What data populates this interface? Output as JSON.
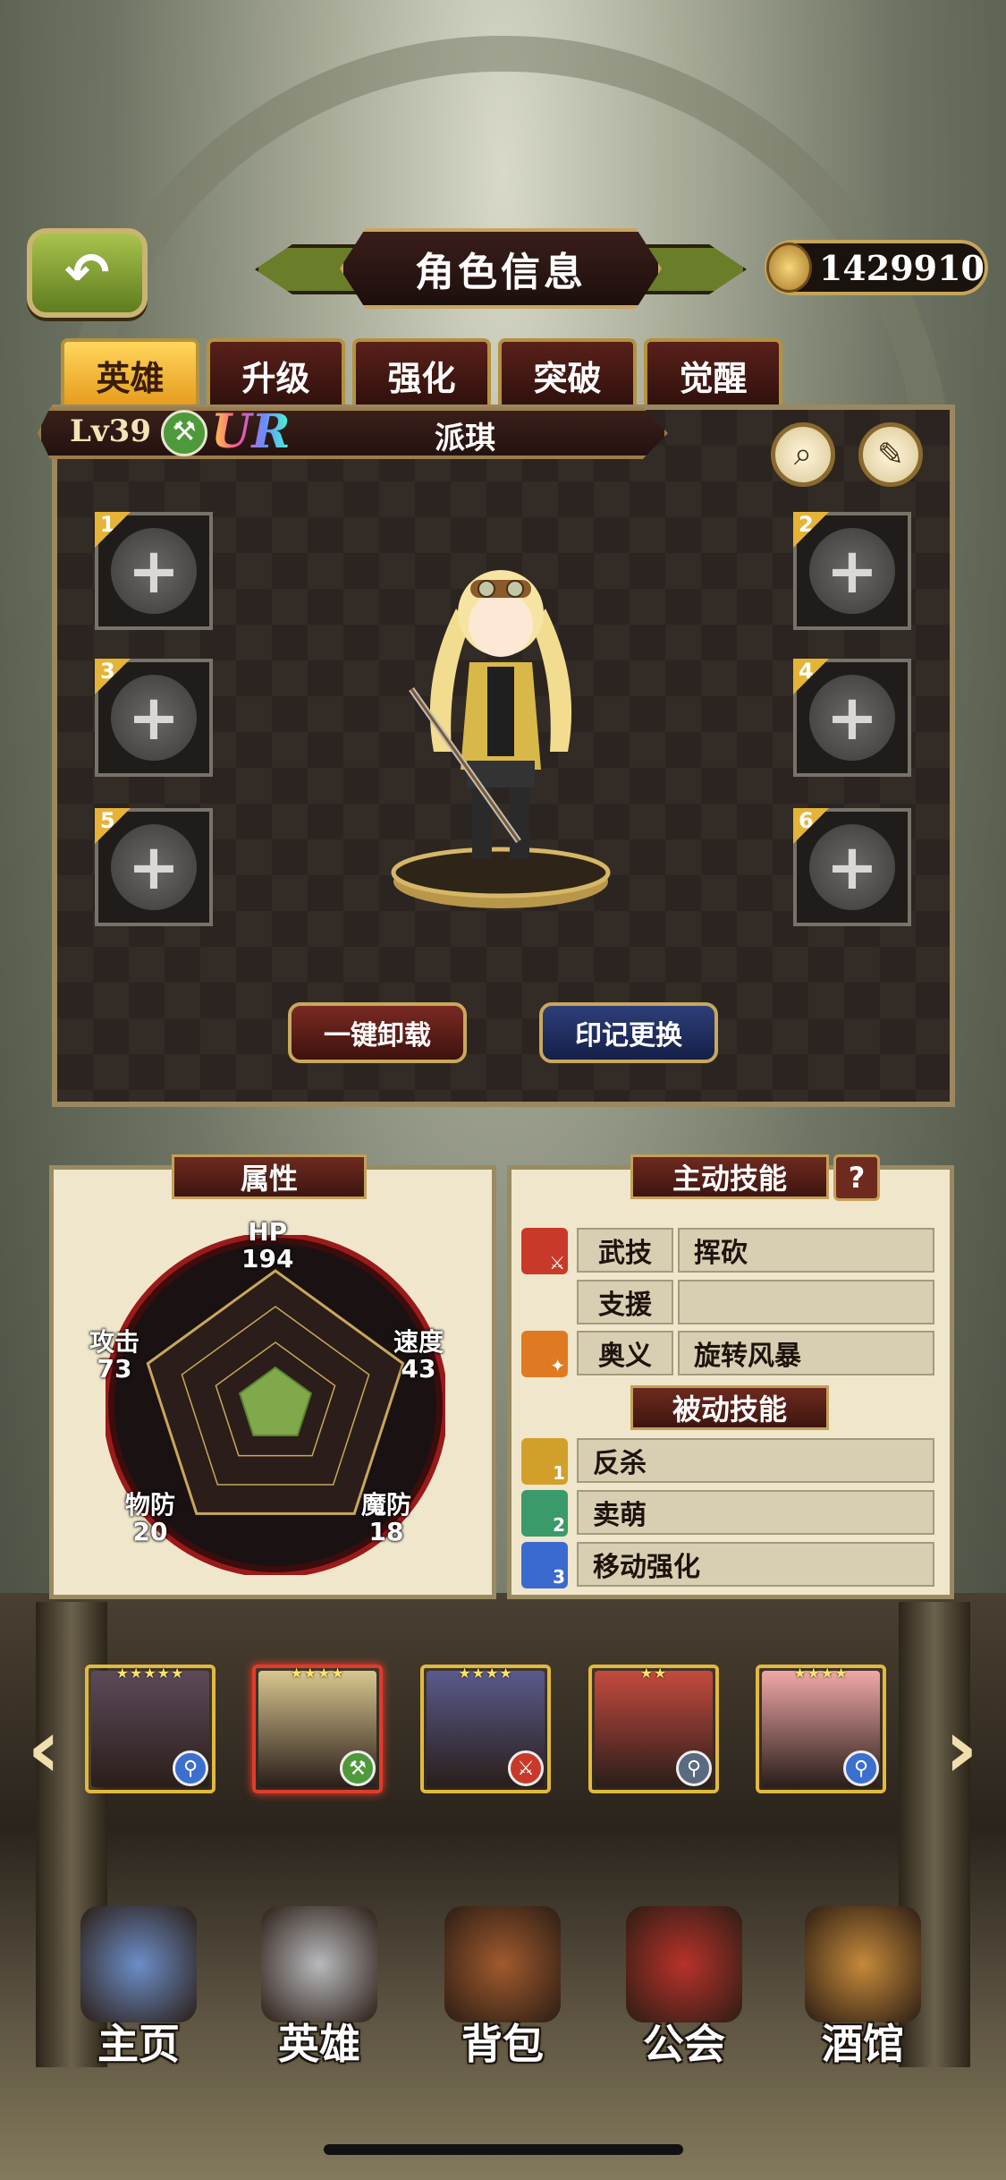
{
  "header": {
    "title": "角色信息",
    "gold": "1429910",
    "back_icon": "back-arrow-icon"
  },
  "tabs": [
    {
      "label": "英雄",
      "active": true
    },
    {
      "label": "升级",
      "active": false
    },
    {
      "label": "强化",
      "active": false
    },
    {
      "label": "突破",
      "active": false
    },
    {
      "label": "觉醒",
      "active": false
    }
  ],
  "hero": {
    "level": "Lv39",
    "rarity": "UR",
    "name": "派琪",
    "class_icon": "axe-icon"
  },
  "slots": [
    "1",
    "2",
    "3",
    "4",
    "5",
    "6"
  ],
  "actions": {
    "unequip_all": "一键卸载",
    "change_mark": "印记更换"
  },
  "attributes": {
    "title": "属性",
    "stats": [
      {
        "name": "HP",
        "value": "194"
      },
      {
        "name": "速度",
        "value": "43"
      },
      {
        "name": "魔防",
        "value": "18"
      },
      {
        "name": "物防",
        "value": "20"
      },
      {
        "name": "攻击",
        "value": "73"
      }
    ]
  },
  "skills": {
    "active_title": "主动技能",
    "help": "?",
    "active": [
      {
        "type": "武技",
        "name": "挥砍"
      },
      {
        "type": "支援",
        "name": ""
      },
      {
        "type": "奥义",
        "name": "旋转风暴"
      }
    ],
    "passive_title": "被动技能",
    "passive": [
      {
        "index": "1",
        "name": "反杀"
      },
      {
        "index": "2",
        "name": "卖萌"
      },
      {
        "index": "3",
        "name": "移动强化"
      }
    ]
  },
  "hero_list": [
    {
      "stars": "★★★★★",
      "class": "staff",
      "class_glyph": "⚲",
      "color": "#3b6fd0",
      "selected": false,
      "portrait": "#5d4a5a"
    },
    {
      "stars": "★★★★",
      "class": "axe",
      "class_glyph": "⚒",
      "color": "#4e9a3a",
      "selected": true,
      "portrait": "#d9c68f"
    },
    {
      "stars": "★★★★",
      "class": "sword",
      "class_glyph": "⚔",
      "color": "#c9392a",
      "selected": false,
      "portrait": "#5a5a8c"
    },
    {
      "stars": "★★",
      "class": "staff",
      "class_glyph": "⚲",
      "color": "#5a6a80",
      "selected": false,
      "portrait": "#c44a3e"
    },
    {
      "stars": "★★★★",
      "class": "staff",
      "class_glyph": "⚲",
      "color": "#3b6fd0",
      "selected": false,
      "portrait": "#f0a8a8"
    }
  ],
  "nav": [
    {
      "label": "主页",
      "icon": "castle-icon",
      "color": "#6c8ec9"
    },
    {
      "label": "英雄",
      "icon": "helmet-icon",
      "color": "#b8b9bd"
    },
    {
      "label": "背包",
      "icon": "backpack-icon",
      "color": "#a05a2e"
    },
    {
      "label": "公会",
      "icon": "shield-icon",
      "color": "#b8322a"
    },
    {
      "label": "酒馆",
      "icon": "tavern-mug-icon",
      "color": "#c58a3a"
    }
  ]
}
